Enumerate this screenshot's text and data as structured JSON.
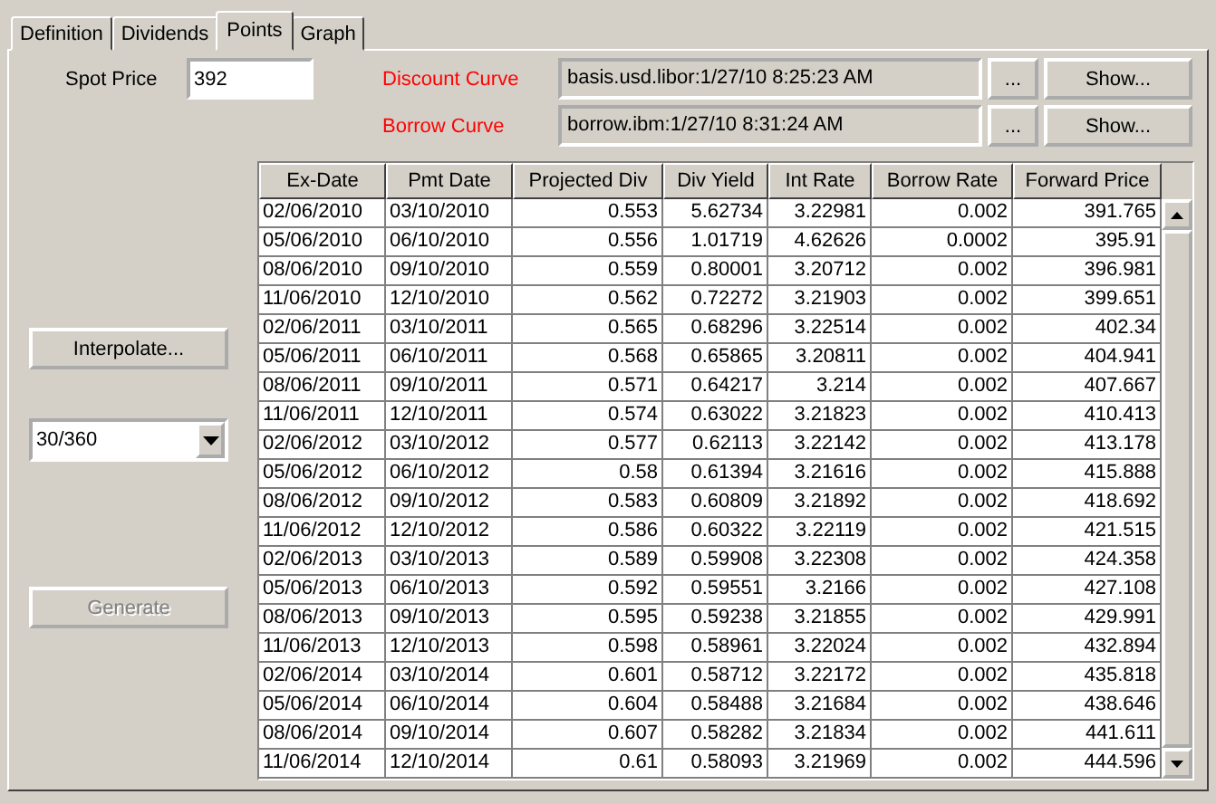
{
  "tabs": [
    {
      "label": "Definition",
      "selected": false
    },
    {
      "label": "Dividends",
      "selected": false
    },
    {
      "label": "Points",
      "selected": true
    },
    {
      "label": "Graph",
      "selected": false
    }
  ],
  "spot_price": {
    "label": "Spot Price",
    "value": "392"
  },
  "curves": [
    {
      "label": "Discount Curve",
      "value": "basis.usd.libor:1/27/10 8:25:23 AM",
      "browse_button": "...",
      "show_button": "Show..."
    },
    {
      "label": "Borrow Curve",
      "value": "borrow.ibm:1/27/10 8:31:24 AM",
      "browse_button": "...",
      "show_button": "Show..."
    }
  ],
  "interpolate_button": {
    "label": "Interpolate...",
    "disabled": false
  },
  "day_count": {
    "value": "30/360"
  },
  "generate_button": {
    "label": "Generate",
    "disabled": true
  },
  "table": {
    "columns": [
      "Ex-Date",
      "Pmt Date",
      "Projected Div",
      "Div Yield",
      "Int Rate",
      "Borrow Rate",
      "Forward Price"
    ],
    "rows": [
      [
        "02/06/2010",
        "03/10/2010",
        "0.553",
        "5.62734",
        "3.22981",
        "0.002",
        "391.765"
      ],
      [
        "05/06/2010",
        "06/10/2010",
        "0.556",
        "1.01719",
        "4.62626",
        "0.0002",
        "395.91"
      ],
      [
        "08/06/2010",
        "09/10/2010",
        "0.559",
        "0.80001",
        "3.20712",
        "0.002",
        "396.981"
      ],
      [
        "11/06/2010",
        "12/10/2010",
        "0.562",
        "0.72272",
        "3.21903",
        "0.002",
        "399.651"
      ],
      [
        "02/06/2011",
        "03/10/2011",
        "0.565",
        "0.68296",
        "3.22514",
        "0.002",
        "402.34"
      ],
      [
        "05/06/2011",
        "06/10/2011",
        "0.568",
        "0.65865",
        "3.20811",
        "0.002",
        "404.941"
      ],
      [
        "08/06/2011",
        "09/10/2011",
        "0.571",
        "0.64217",
        "3.214",
        "0.002",
        "407.667"
      ],
      [
        "11/06/2011",
        "12/10/2011",
        "0.574",
        "0.63022",
        "3.21823",
        "0.002",
        "410.413"
      ],
      [
        "02/06/2012",
        "03/10/2012",
        "0.577",
        "0.62113",
        "3.22142",
        "0.002",
        "413.178"
      ],
      [
        "05/06/2012",
        "06/10/2012",
        "0.58",
        "0.61394",
        "3.21616",
        "0.002",
        "415.888"
      ],
      [
        "08/06/2012",
        "09/10/2012",
        "0.583",
        "0.60809",
        "3.21892",
        "0.002",
        "418.692"
      ],
      [
        "11/06/2012",
        "12/10/2012",
        "0.586",
        "0.60322",
        "3.22119",
        "0.002",
        "421.515"
      ],
      [
        "02/06/2013",
        "03/10/2013",
        "0.589",
        "0.59908",
        "3.22308",
        "0.002",
        "424.358"
      ],
      [
        "05/06/2013",
        "06/10/2013",
        "0.592",
        "0.59551",
        "3.2166",
        "0.002",
        "427.108"
      ],
      [
        "08/06/2013",
        "09/10/2013",
        "0.595",
        "0.59238",
        "3.21855",
        "0.002",
        "429.991"
      ],
      [
        "11/06/2013",
        "12/10/2013",
        "0.598",
        "0.58961",
        "3.22024",
        "0.002",
        "432.894"
      ],
      [
        "02/06/2014",
        "03/10/2014",
        "0.601",
        "0.58712",
        "3.22172",
        "0.002",
        "435.818"
      ],
      [
        "05/06/2014",
        "06/10/2014",
        "0.604",
        "0.58488",
        "3.21684",
        "0.002",
        "438.646"
      ],
      [
        "08/06/2014",
        "09/10/2014",
        "0.607",
        "0.58282",
        "3.21834",
        "0.002",
        "441.611"
      ],
      [
        "11/06/2014",
        "12/10/2014",
        "0.61",
        "0.58093",
        "3.21969",
        "0.002",
        "444.596"
      ]
    ]
  }
}
